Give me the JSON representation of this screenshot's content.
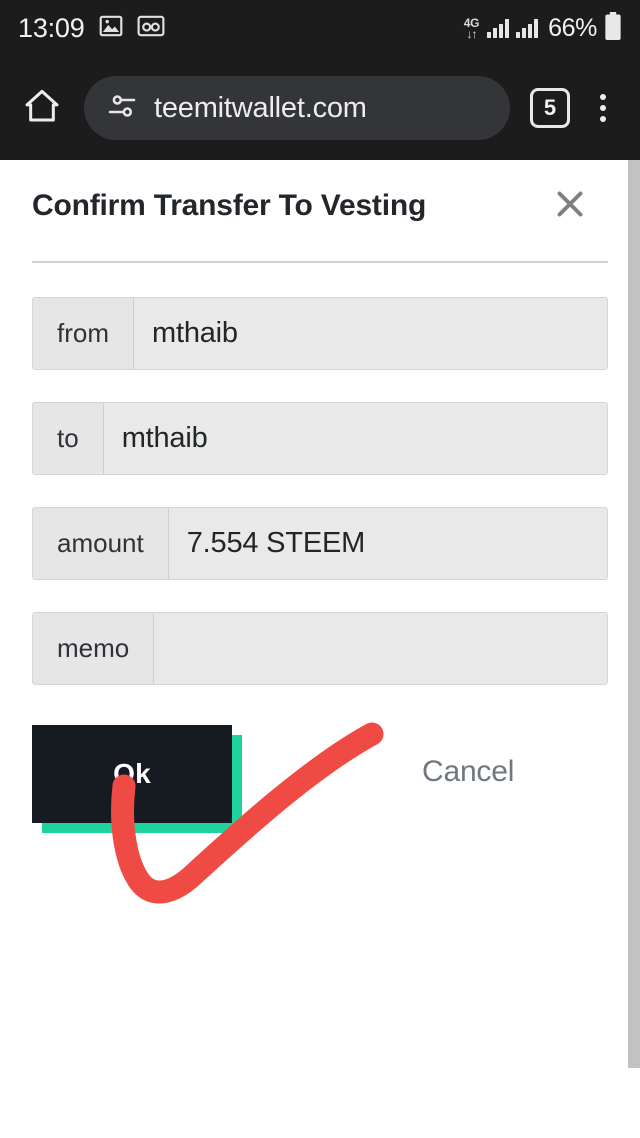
{
  "status_bar": {
    "clock": "13:09",
    "icons": [
      "image-icon",
      "voicemail-icon"
    ],
    "network_type": "4G",
    "network_arrows": "↓↑",
    "battery_percent": "66%"
  },
  "browser": {
    "home_icon": "home-icon",
    "site_settings_icon": "tune-icon",
    "url": "teemitwallet.com",
    "tab_count": "5",
    "menu_icon": "overflow-menu-icon"
  },
  "dialog": {
    "title": "Confirm Transfer To Vesting",
    "close_icon": "close-icon",
    "fields": [
      {
        "label": "from",
        "value": "mthaib"
      },
      {
        "label": "to",
        "value": "mthaib"
      },
      {
        "label": "amount",
        "value": "7.554 STEEM"
      },
      {
        "label": "memo",
        "value": ""
      }
    ],
    "ok_label": "Ok",
    "cancel_label": "Cancel"
  },
  "annotation": {
    "type": "checkmark",
    "color": "#ef4b44"
  },
  "colors": {
    "status_bar_bg": "#1c1c1c",
    "browser_bg": "#1c1c1c",
    "omnibox_bg": "#333538",
    "page_bg": "#ffffff",
    "field_bg": "#e9e9e9",
    "field_label_bg": "#e6e6e6",
    "field_border": "#d6d6d6",
    "ok_button_bg": "#161b22",
    "ok_button_shadow": "#1fd39f",
    "cancel_text": "#6f7780",
    "title_text": "#23272b",
    "annotation_red": "#ef4b44",
    "scrollbar_thumb": "#c2c2c2"
  }
}
